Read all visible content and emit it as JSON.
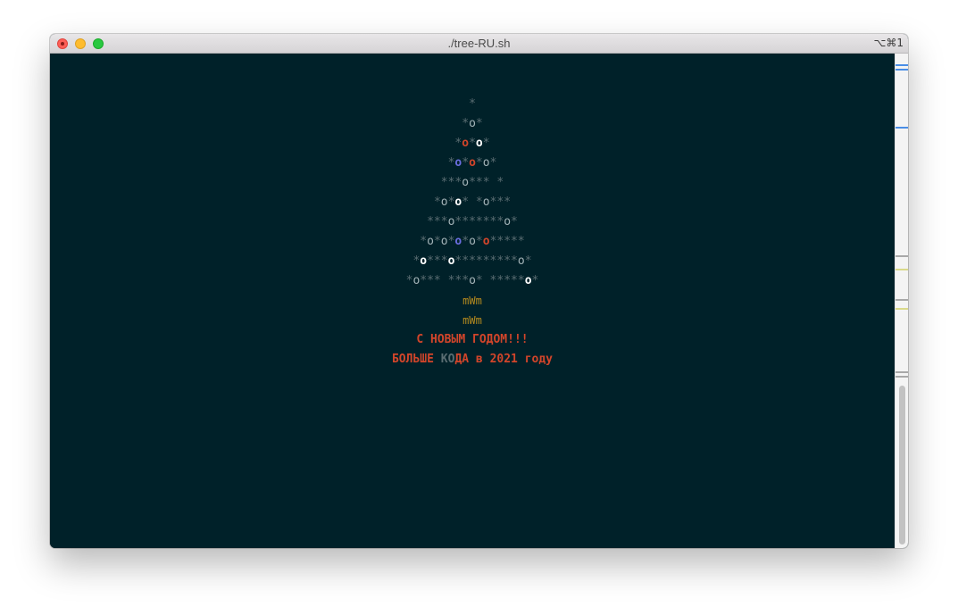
{
  "window": {
    "title": "./tree-RU.sh",
    "shortcut": "⌥⌘1"
  },
  "colors": {
    "background": "#002129",
    "star": "#5a6d72",
    "ornament_grey": "#a4b4b8",
    "ornament_white": "#ffffff",
    "ornament_red": "#d2452a",
    "ornament_blue": "#6b6ee0",
    "trunk": "#b48a1e",
    "greeting": "#d2452a"
  },
  "tree": [
    [
      {
        "t": "*",
        "c": "s"
      }
    ],
    [
      {
        "t": "*",
        "c": "s"
      },
      {
        "t": "o",
        "c": "g"
      },
      {
        "t": "*",
        "c": "s"
      }
    ],
    [
      {
        "t": "*",
        "c": "s"
      },
      {
        "t": "o",
        "c": "r"
      },
      {
        "t": "*",
        "c": "s"
      },
      {
        "t": "o",
        "c": "w"
      },
      {
        "t": "*",
        "c": "s"
      }
    ],
    [
      {
        "t": "*",
        "c": "s"
      },
      {
        "t": "o",
        "c": "b"
      },
      {
        "t": "*",
        "c": "s"
      },
      {
        "t": "o",
        "c": "r"
      },
      {
        "t": "*",
        "c": "s"
      },
      {
        "t": "o",
        "c": "g"
      },
      {
        "t": "*",
        "c": "s"
      }
    ],
    [
      {
        "t": "***",
        "c": "s"
      },
      {
        "t": "o",
        "c": "g"
      },
      {
        "t": "*** *",
        "c": "s"
      }
    ],
    [
      {
        "t": "*",
        "c": "s"
      },
      {
        "t": "o",
        "c": "g"
      },
      {
        "t": "*",
        "c": "s"
      },
      {
        "t": "o",
        "c": "w"
      },
      {
        "t": "* *",
        "c": "s"
      },
      {
        "t": "o",
        "c": "g"
      },
      {
        "t": "***",
        "c": "s"
      }
    ],
    [
      {
        "t": "***",
        "c": "s"
      },
      {
        "t": "o",
        "c": "g"
      },
      {
        "t": "*******",
        "c": "s"
      },
      {
        "t": "o",
        "c": "g"
      },
      {
        "t": "*",
        "c": "s"
      }
    ],
    [
      {
        "t": "*",
        "c": "s"
      },
      {
        "t": "o",
        "c": "g"
      },
      {
        "t": "*",
        "c": "s"
      },
      {
        "t": "o",
        "c": "g"
      },
      {
        "t": "*",
        "c": "s"
      },
      {
        "t": "o",
        "c": "b"
      },
      {
        "t": "*",
        "c": "s"
      },
      {
        "t": "o",
        "c": "g"
      },
      {
        "t": "*",
        "c": "s"
      },
      {
        "t": "o",
        "c": "r"
      },
      {
        "t": "*****",
        "c": "s"
      }
    ],
    [
      {
        "t": "*",
        "c": "s"
      },
      {
        "t": "o",
        "c": "w"
      },
      {
        "t": "***",
        "c": "s"
      },
      {
        "t": "o",
        "c": "w"
      },
      {
        "t": "*********",
        "c": "s"
      },
      {
        "t": "o",
        "c": "g"
      },
      {
        "t": "*",
        "c": "s"
      }
    ],
    [
      {
        "t": "*",
        "c": "s"
      },
      {
        "t": "o",
        "c": "g"
      },
      {
        "t": "*** ***",
        "c": "s"
      },
      {
        "t": "o",
        "c": "g"
      },
      {
        "t": "* *****",
        "c": "s"
      },
      {
        "t": "o",
        "c": "w"
      },
      {
        "t": "*",
        "c": "s"
      }
    ]
  ],
  "trunk": [
    "mWm",
    "mWm"
  ],
  "greeting": "С НОВЫМ ГОДОМ!!!",
  "wish": [
    {
      "t": "БОЛЬШЕ ",
      "c": "red"
    },
    {
      "t": "КО",
      "c": "s"
    },
    {
      "t": "ДА в 2021 году",
      "c": "red"
    }
  ]
}
